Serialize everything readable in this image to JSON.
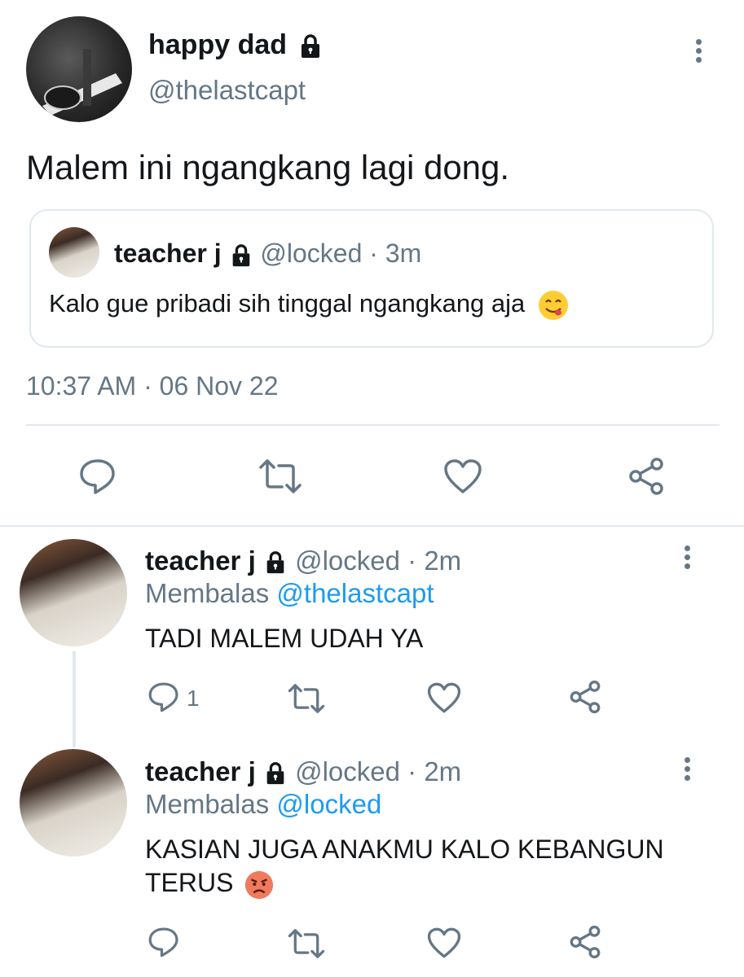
{
  "main_tweet": {
    "display_name": "happy dad",
    "handle": "@thelastcapt",
    "text": "Malem ini ngangkang lagi dong.",
    "timestamp": "10:37 AM · 06 Nov 22",
    "quoted": {
      "display_name": "teacher j",
      "handle": "@locked",
      "time": "· 3m",
      "text": "Kalo gue pribadi sih tinggal ngangkang aja"
    }
  },
  "replies": [
    {
      "display_name": "teacher j",
      "handle": "@locked",
      "time": "· 2m",
      "replying_prefix": "Membalas",
      "replying_to": "@thelastcapt",
      "text": "TADI MALEM UDAH YA",
      "reply_count": "1"
    },
    {
      "display_name": "teacher j",
      "handle": "@locked",
      "time": "· 2m",
      "replying_prefix": "Membalas",
      "replying_to": "@locked",
      "text_line1": "KASIAN JUGA ANAKMU KALO KEBANGUN",
      "text_line2": "TERUS"
    }
  ],
  "icons": {
    "lock": "lock-icon",
    "more": "more-vertical-icon",
    "reply": "reply-bubble-icon",
    "retweet": "retweet-icon",
    "like": "heart-icon",
    "share": "share-icon"
  },
  "colors": {
    "text": "#14171a",
    "secondary": "#657786",
    "link": "#1d9bf0",
    "border": "#e1e8ed"
  }
}
